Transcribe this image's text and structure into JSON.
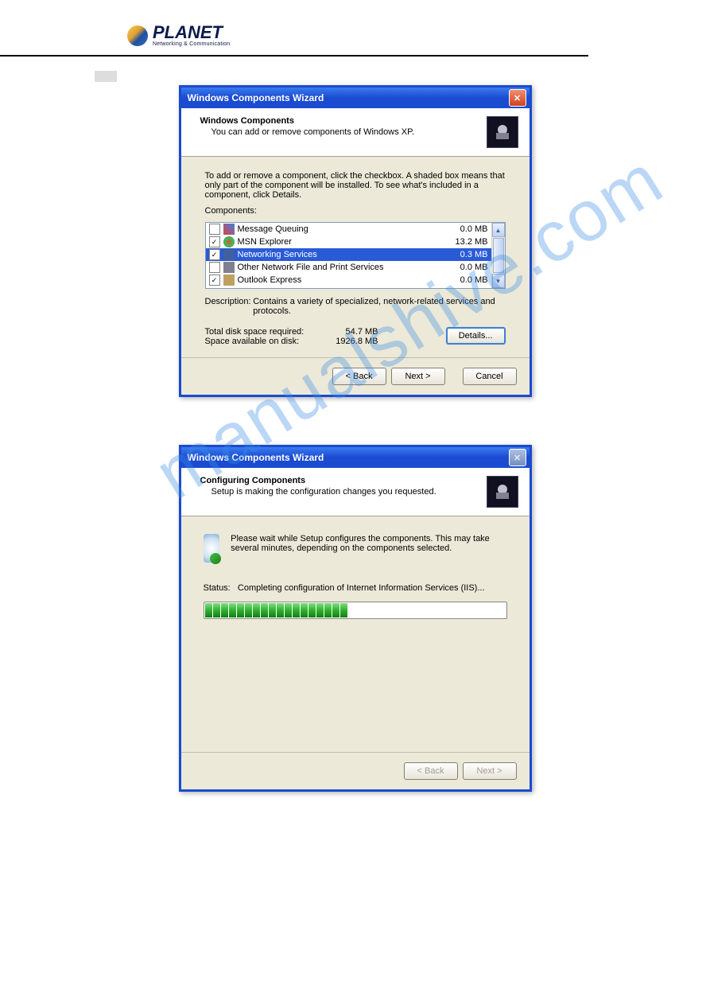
{
  "brand": {
    "name": "PLANET",
    "tagline": "Networking & Communication"
  },
  "watermark": "manualshive.com",
  "dialog1": {
    "title": "Windows Components Wizard",
    "heading": "Windows Components",
    "subheading": "You can add or remove components of Windows XP.",
    "instruction": "To add or remove a component, click the checkbox. A shaded box means that only part of the component will be installed. To see what's included in a component, click Details.",
    "components_label": "Components:",
    "components": [
      {
        "checked": false,
        "name": "Message Queuing",
        "size": "0.0 MB"
      },
      {
        "checked": true,
        "name": "MSN Explorer",
        "size": "13.2 MB"
      },
      {
        "checked": true,
        "name": "Networking Services",
        "size": "0.3 MB",
        "selected": true
      },
      {
        "checked": false,
        "name": "Other Network File and Print Services",
        "size": "0.0 MB"
      },
      {
        "checked": true,
        "name": "Outlook Express",
        "size": "0.0 MB"
      }
    ],
    "description_label": "Description:",
    "description": "Contains a variety of specialized, network-related services and protocols.",
    "total_label": "Total disk space required:",
    "total_value": "54.7 MB",
    "avail_label": "Space available on disk:",
    "avail_value": "1926.8 MB",
    "details_btn": "Details...",
    "back_btn": "< Back",
    "next_btn": "Next >",
    "cancel_btn": "Cancel"
  },
  "dialog2": {
    "title": "Windows Components Wizard",
    "heading": "Configuring Components",
    "subheading": "Setup is making the configuration changes you requested.",
    "wait_msg": "Please wait while Setup configures the components. This may take several minutes, depending on the components selected.",
    "status_label": "Status:",
    "status_text": "Completing configuration of Internet Information Services (IIS)...",
    "back_btn": "< Back",
    "next_btn": "Next >"
  }
}
